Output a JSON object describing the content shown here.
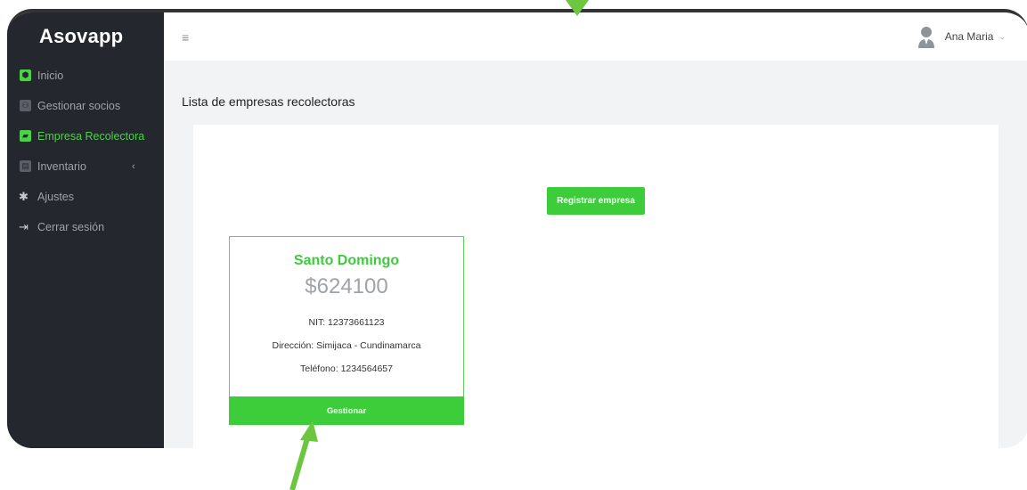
{
  "app": {
    "brand": "Asovapp"
  },
  "sidebar": {
    "items": [
      {
        "label": "Inicio",
        "icon": "home-icon"
      },
      {
        "label": "Gestionar socios",
        "icon": "users-icon"
      },
      {
        "label": "Empresa Recolectora",
        "icon": "truck-icon",
        "active": true
      },
      {
        "label": "Inventario",
        "icon": "inventory-icon",
        "chevron": "‹"
      },
      {
        "label": "Ajustes",
        "icon": "gear-icon"
      },
      {
        "label": "Cerrar sesión",
        "icon": "logout-icon"
      }
    ]
  },
  "topbar": {
    "menu_icon": "≡",
    "user_name": "Ana Maria",
    "caret": "⌄"
  },
  "main": {
    "title": "Lista de empresas recolectoras",
    "register_label": "Registrar empresa",
    "companies": [
      {
        "name": "Santo Domingo",
        "amount": "$624100",
        "nit": "NIT: 12373661123",
        "address": "Dirección: Simijaca - Cundinamarca",
        "phone": "Teléfono: 1234564657",
        "manage_label": "Gestionar"
      }
    ]
  },
  "colors": {
    "accent": "#3dcc3a",
    "sidebar": "#24272d",
    "arrow": "#6cc63f"
  }
}
